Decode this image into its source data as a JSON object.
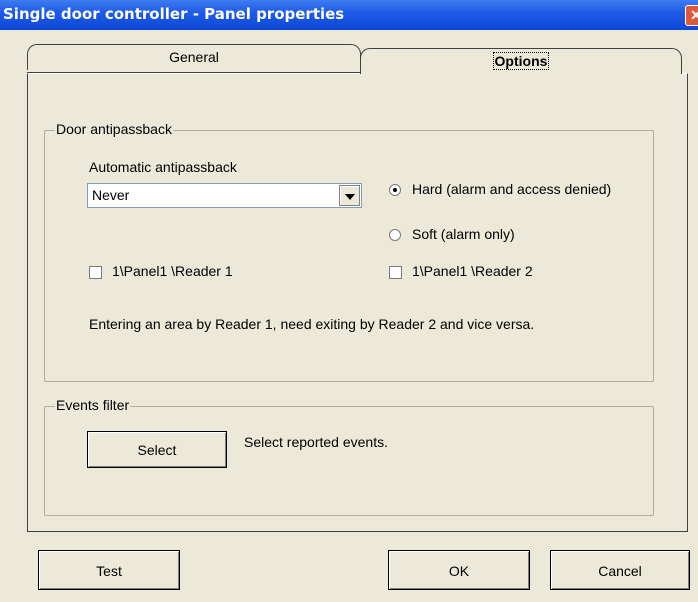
{
  "window": {
    "title": "Single door controller - Panel properties"
  },
  "tabs": {
    "general": "General",
    "options": "Options"
  },
  "antipassback": {
    "legend": "Door antipassback",
    "auto_label": "Automatic antipassback",
    "auto_value": "Never",
    "hard_label": "Hard (alarm and access denied)",
    "soft_label": "Soft (alarm only)",
    "selected_mode": "hard",
    "reader1_label": "1\\Panel1 \\Reader 1",
    "reader2_label": "1\\Panel1 \\Reader 2",
    "reader1_checked": false,
    "reader2_checked": false,
    "note": "Entering an area by Reader 1, need exiting by Reader 2 and vice versa."
  },
  "events": {
    "legend": "Events filter",
    "select_label": "Select",
    "description": "Select reported events."
  },
  "footer": {
    "test_label": "Test",
    "ok_label": "OK",
    "cancel_label": "Cancel"
  }
}
